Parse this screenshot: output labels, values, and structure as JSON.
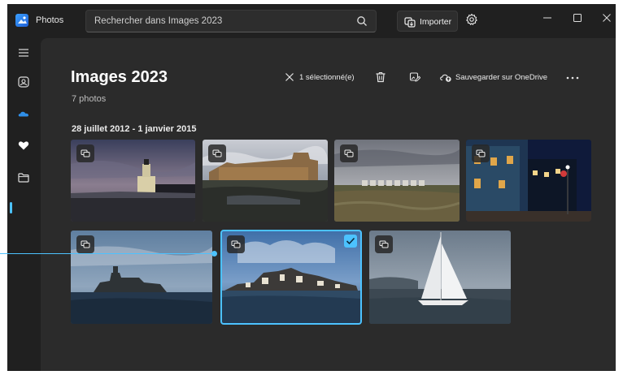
{
  "app": {
    "title": "Photos"
  },
  "search": {
    "placeholder": "Rechercher dans Images 2023"
  },
  "header": {
    "import_label": "Importer"
  },
  "album": {
    "title": "Images 2023",
    "count_label": "7 photos",
    "date_range": "28 juillet 2012 - 1 janvier 2015"
  },
  "toolbar": {
    "selected_label": "1 sélectionné(e)",
    "onedrive_label": "Sauvegarder sur OneDrive"
  },
  "photos": [
    {
      "name": "lighthouse-dusk",
      "selected": false
    },
    {
      "name": "fortress-wall",
      "selected": false
    },
    {
      "name": "beach-huts",
      "selected": false
    },
    {
      "name": "night-street",
      "selected": false
    },
    {
      "name": "island-castle",
      "selected": false
    },
    {
      "name": "coastal-town",
      "selected": true
    },
    {
      "name": "sailboat",
      "selected": false
    }
  ],
  "colors": {
    "accent": "#4cc2ff",
    "background": "#202020",
    "panel": "#2b2b2b"
  }
}
